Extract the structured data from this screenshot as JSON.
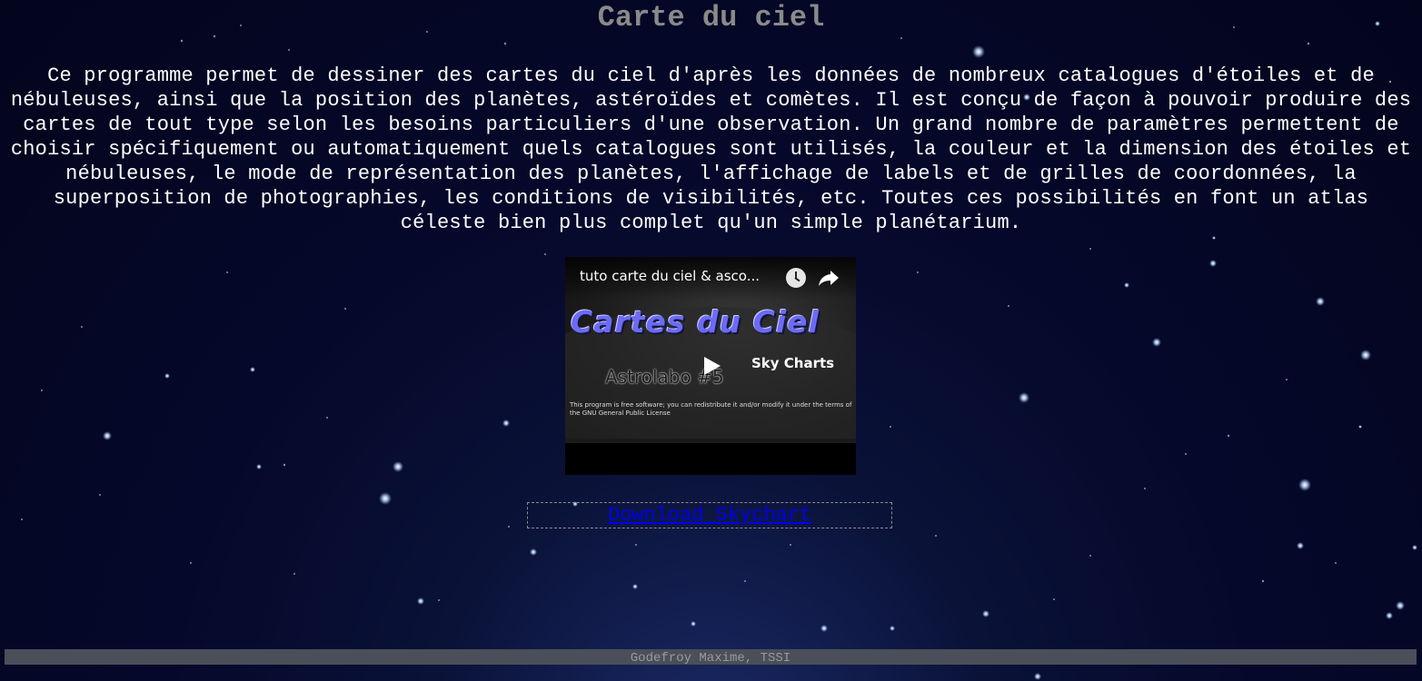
{
  "page": {
    "title": "Carte du ciel",
    "description": "Ce programme permet de dessiner des cartes du ciel d'après les données de nombreux catalogues d'étoiles et de nébuleuses, ainsi que la position des planètes, astéroïdes et comètes. Il est conçu de façon à pouvoir produire des cartes de tout type selon les besoins particuliers d'une observation. Un grand nombre de paramètres permettent de choisir spécifiquement ou automatiquement quels catalogues sont utilisés, la couleur et la dimension des étoiles et nébuleuses, le mode de représentation des planètes, l'affichage de labels et de grilles de coordonnées, la superposition de photographies, les conditions de visibilités, etc. Toutes ces possibilités en font un atlas céleste bien plus complet qu'un simple planétarium."
  },
  "video": {
    "title": "tuto carte du ciel & asco...",
    "thumbnail_title": "Cartes du Ciel",
    "thumbnail_subtitle": "Astrolabo #5",
    "thumbnail_brand": "Sky Charts",
    "thumbnail_license": "This program is free software; you can redistribute it and/or modify it under the terms of the GNU General Public License",
    "icons": [
      "play-icon",
      "watch-later-icon",
      "share-icon"
    ]
  },
  "download": {
    "label": "Download Skychart"
  },
  "footer": {
    "text": "Godefroy Maxime, TSSI"
  },
  "colors": {
    "background": "#05082a",
    "title": "#8a8a8a",
    "link": "#0000ee",
    "footer_bg": "#4a4f59"
  }
}
